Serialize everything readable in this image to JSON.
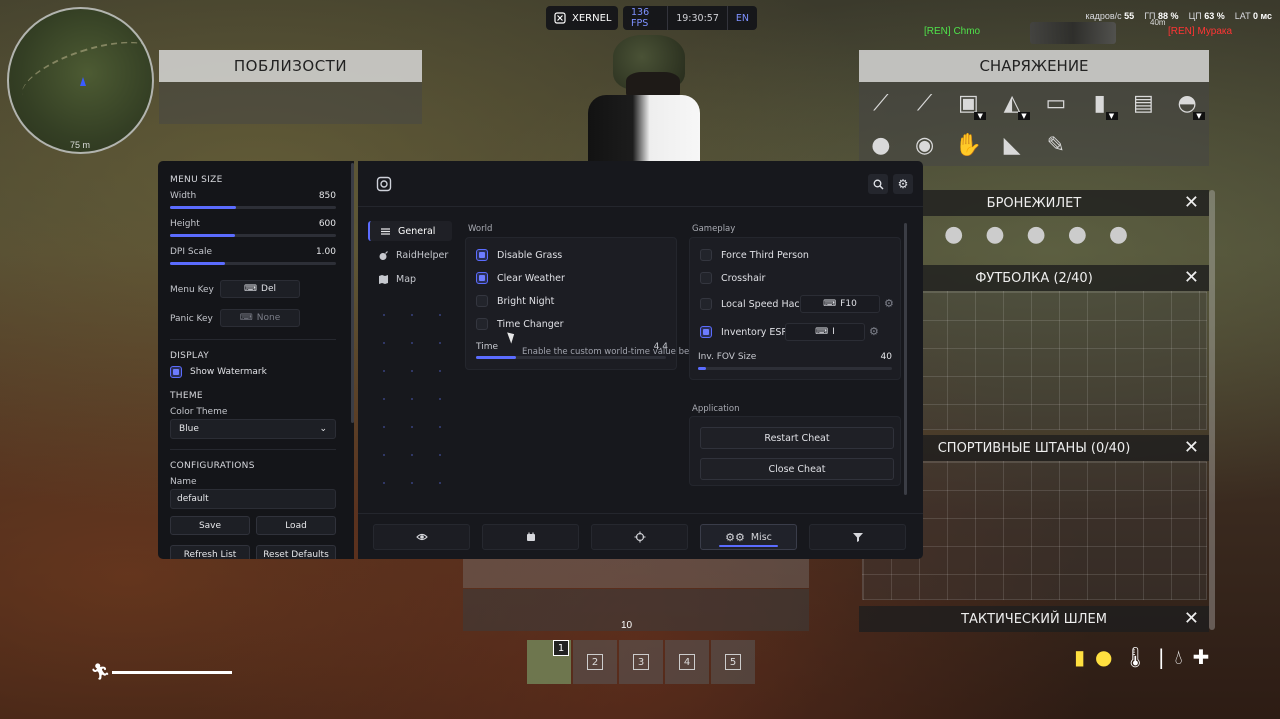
{
  "hud": {
    "brand": "XERNEL",
    "fps": "136 FPS",
    "clock": "19:30:57",
    "lang": "EN",
    "stats": {
      "frames_label": "кадров/с",
      "frames": "55",
      "gpu_label": "ГП",
      "gpu": "88 %",
      "cpu_label": "ЦП",
      "cpu": "63 %",
      "lat_label": "LAT",
      "lat": "0 мс"
    },
    "player_tag": "[REN] Chmo",
    "enemy_tag": "[REN] Мурака",
    "distance": "40m",
    "minimap_scale": "75 m",
    "mag_count": "10",
    "hotbar": [
      "1",
      "2",
      "3",
      "4",
      "5"
    ],
    "stamina_level": 1.0
  },
  "near_panel": {
    "title": "ПОБЛИЗОСТИ"
  },
  "equipment": {
    "title": "СНАРЯЖЕНИЕ",
    "sections": [
      {
        "title": "БРОНЕЖИЛЕТ"
      },
      {
        "title": "ФУТБОЛКА (2/40)"
      },
      {
        "title": "СПОРТИВНЫЕ ШТАНЫ (0/40)"
      },
      {
        "title": "ТАКТИЧЕСКИЙ ШЛЕМ"
      }
    ]
  },
  "menu": {
    "sidebar": {
      "menu_size_label": "MENU SIZE",
      "width_label": "Width",
      "width_value": "850",
      "width_fraction": 0.4,
      "height_label": "Height",
      "height_value": "600",
      "height_fraction": 0.39,
      "dpi_label": "DPI Scale",
      "dpi_value": "1.00",
      "dpi_fraction": 0.33,
      "menu_key_label": "Menu Key",
      "menu_key_value": "Del",
      "panic_key_label": "Panic Key",
      "panic_key_value": "None",
      "display_label": "DISPLAY",
      "show_watermark_label": "Show Watermark",
      "show_watermark": true,
      "theme_label": "THEME",
      "color_theme_label": "Color Theme",
      "color_theme_value": "Blue",
      "configurations_label": "CONFIGURATIONS",
      "name_label": "Name",
      "name_value": "default",
      "save_label": "Save",
      "load_label": "Load",
      "refresh_label": "Refresh List",
      "reset_label": "Reset Defaults"
    },
    "nav": [
      {
        "label": "General",
        "active": true
      },
      {
        "label": "RaidHelper",
        "active": false
      },
      {
        "label": "Map",
        "active": false
      }
    ],
    "world": {
      "title": "World",
      "items": [
        {
          "label": "Disable Grass",
          "checked": true
        },
        {
          "label": "Clear Weather",
          "checked": true
        },
        {
          "label": "Bright Night",
          "checked": false
        },
        {
          "label": "Time Changer",
          "checked": false
        }
      ],
      "time_label": "Time",
      "time_value": "4.4",
      "time_fraction": 0.21,
      "tooltip": "Enable the custom world-time value below"
    },
    "gameplay": {
      "title": "Gameplay",
      "force_third_person": "Force Third Person",
      "crosshair": "Crosshair",
      "local_speed_hack": "Local Speed Hack",
      "speed_key": "F10",
      "inventory_esp": "Inventory ESP",
      "inventory_key": "I",
      "fov_label": "Inv. FOV Size",
      "fov_value": "40",
      "fov_fraction": 0.04,
      "checked": {
        "force_third_person": false,
        "crosshair": false,
        "local_speed_hack": false,
        "inventory_esp": true
      }
    },
    "application": {
      "title": "Application",
      "restart": "Restart Cheat",
      "close": "Close Cheat"
    },
    "footer_tabs": [
      {
        "icon": "eye-icon",
        "label": ""
      },
      {
        "icon": "calendar-icon",
        "label": ""
      },
      {
        "icon": "crosshair-icon",
        "label": ""
      },
      {
        "icon": "gears-icon",
        "label": "Misc",
        "active": true
      },
      {
        "icon": "filter-icon",
        "label": ""
      }
    ],
    "accent_color": "#5b6cff"
  }
}
